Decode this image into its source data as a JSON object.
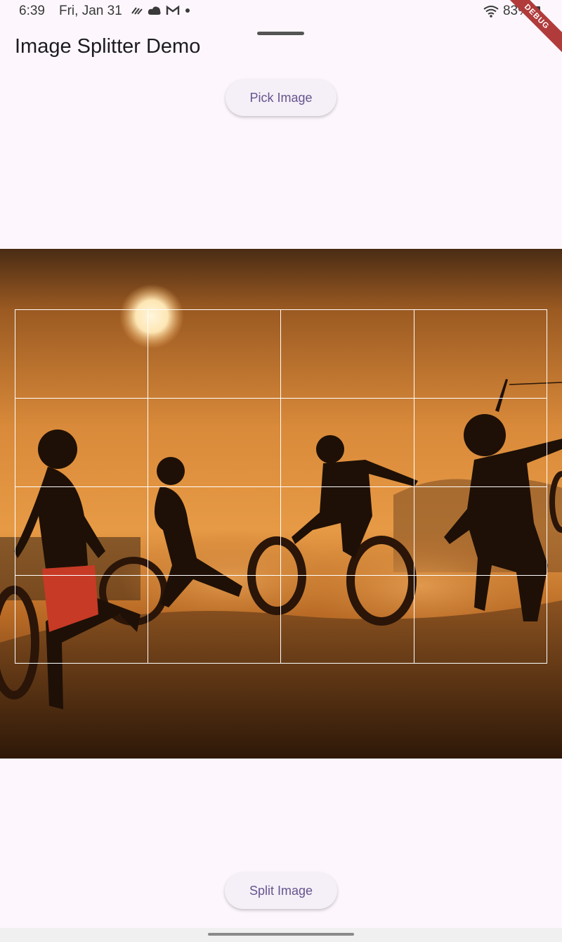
{
  "status": {
    "time": "6:39",
    "date": "Fri, Jan 31",
    "battery": "83%"
  },
  "debug_banner": "DEBUG",
  "app": {
    "title": "Image Splitter Demo"
  },
  "buttons": {
    "pick_label": "Pick Image",
    "split_label": "Split Image"
  },
  "grid": {
    "rows": 4,
    "cols": 4
  },
  "colors": {
    "background": "#fdf7fd",
    "button_bg": "#f5eff7",
    "button_text": "#65558f",
    "grid_lines": "#ffffff",
    "debug": "#b13b3b"
  }
}
